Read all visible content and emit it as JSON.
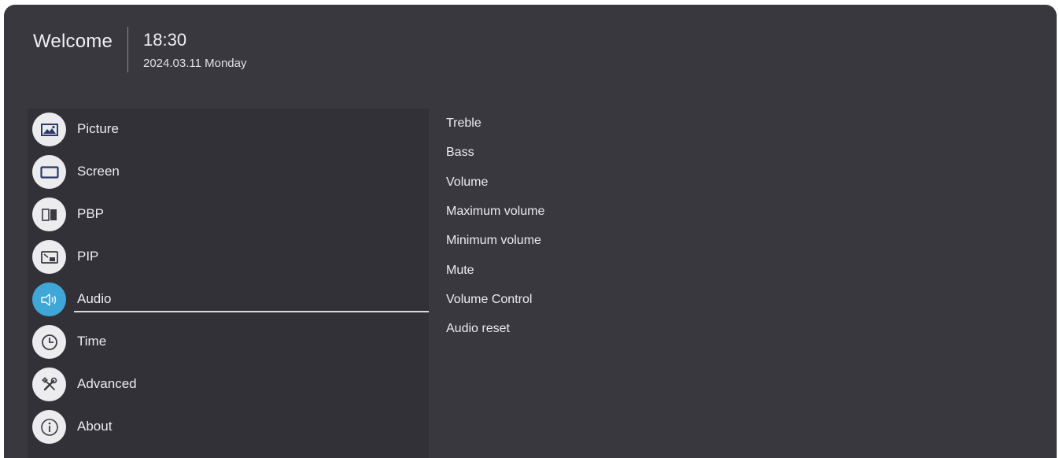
{
  "header": {
    "welcome": "Welcome",
    "time": "18:30",
    "date": "2024.03.11 Monday"
  },
  "sidebar": {
    "items": [
      {
        "label": "Picture",
        "icon": "picture-icon"
      },
      {
        "label": "Screen",
        "icon": "screen-icon"
      },
      {
        "label": "PBP",
        "icon": "pbp-icon"
      },
      {
        "label": "PIP",
        "icon": "pip-icon"
      },
      {
        "label": "Audio",
        "icon": "speaker-icon",
        "active": true
      },
      {
        "label": "Time",
        "icon": "clock-icon"
      },
      {
        "label": "Advanced",
        "icon": "tools-icon"
      },
      {
        "label": "About",
        "icon": "info-icon"
      }
    ]
  },
  "submenu": {
    "items": [
      "Treble",
      "Bass",
      "Volume",
      "Maximum volume",
      "Minimum volume",
      "Mute",
      "Volume Control",
      "Audio reset"
    ]
  },
  "colors": {
    "background": "#39383f",
    "sidebar": "#323137",
    "accent": "#3fa6d8",
    "icon_fg": "#2b3a6b"
  }
}
